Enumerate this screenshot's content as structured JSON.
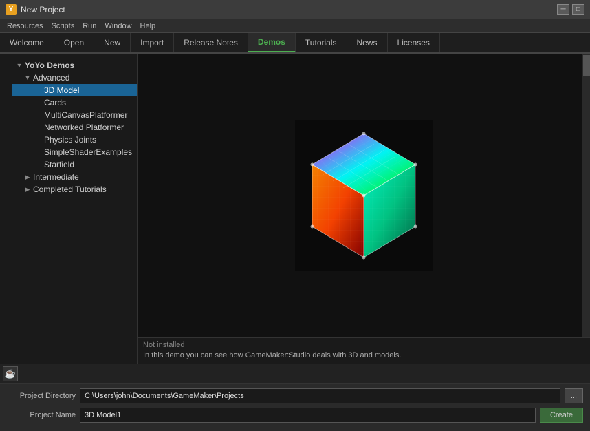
{
  "titleBar": {
    "title": "New Project",
    "iconText": "Y"
  },
  "menuBar": {
    "items": [
      "Resources",
      "Scripts",
      "Run",
      "Window",
      "Help"
    ]
  },
  "tabs": [
    {
      "id": "welcome",
      "label": "Welcome",
      "active": false
    },
    {
      "id": "open",
      "label": "Open",
      "active": false
    },
    {
      "id": "new",
      "label": "New",
      "active": false
    },
    {
      "id": "import",
      "label": "Import",
      "active": false
    },
    {
      "id": "release-notes",
      "label": "Release Notes",
      "active": false
    },
    {
      "id": "demos",
      "label": "Demos",
      "active": true
    },
    {
      "id": "tutorials",
      "label": "Tutorials",
      "active": false
    },
    {
      "id": "news",
      "label": "News",
      "active": false
    },
    {
      "id": "licenses",
      "label": "Licenses",
      "active": false
    }
  ],
  "tree": {
    "rootLabel": "YoYo Demos",
    "advancedLabel": "Advanced",
    "selectedItem": "3D Model",
    "advancedItems": [
      "3D Model",
      "Cards",
      "MultiCanvasPlatformer",
      "Networked Platformer",
      "Physics Joints",
      "SimpleShaderExamples",
      "Starfield"
    ],
    "intermediateLabel": "Intermediate",
    "completedLabel": "Completed Tutorials"
  },
  "preview": {
    "statusLabel": "Not installed",
    "description": "In this demo you can see how GameMaker:Studio deals with 3D and models."
  },
  "bottomBar": {
    "directoryLabel": "Project Directory",
    "directoryValue": "C:\\Users\\john\\Documents\\GameMaker\\Projects",
    "browseBtnLabel": "...",
    "nameLabel": "Project Name",
    "nameValue": "3D Model1",
    "createBtnLabel": "Create"
  }
}
